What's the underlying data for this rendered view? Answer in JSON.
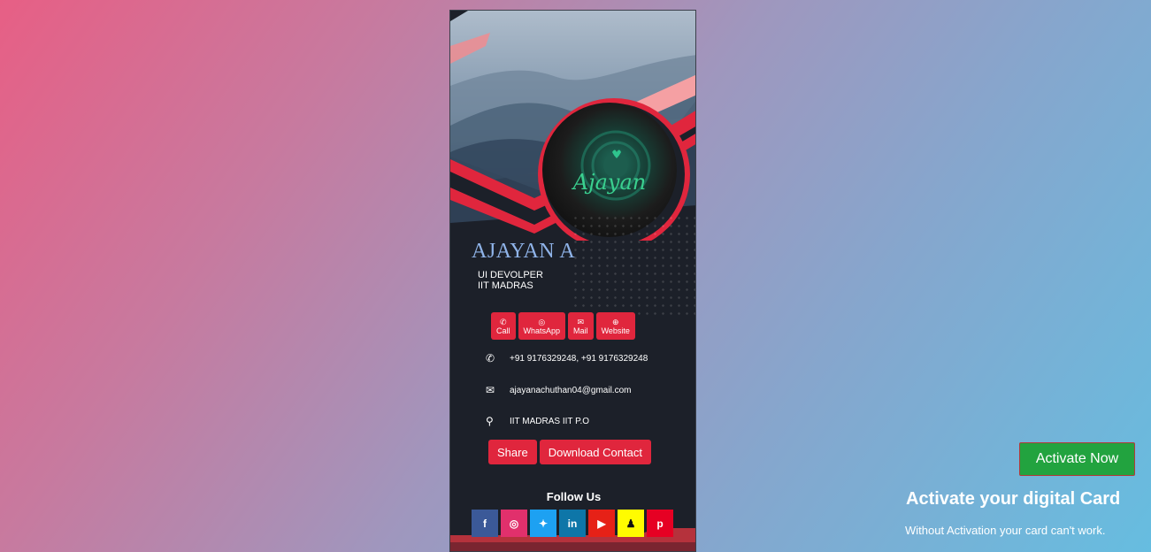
{
  "card": {
    "name": "AJAYAN A",
    "role": "UI DEVOLPER",
    "org": "IIT MADRAS",
    "logo_text": "Ajayan",
    "actions": [
      {
        "label": "Call",
        "icon": "phone-icon",
        "glyph": "✆"
      },
      {
        "label": "WhatsApp",
        "icon": "whatsapp-icon",
        "glyph": "◎"
      },
      {
        "label": "Mail",
        "icon": "mail-icon",
        "glyph": "✉"
      },
      {
        "label": "Website",
        "icon": "globe-icon",
        "glyph": "⊕"
      }
    ],
    "info": {
      "phone": "+91 9176329248, +91 9176329248",
      "email": "ajayanachuthan04@gmail.com",
      "address": "IIT MADRAS IIT P.O"
    },
    "share_label": "Share",
    "download_label": "Download Contact",
    "follow_label": "Follow Us",
    "socials": [
      {
        "name": "facebook",
        "glyph": "f",
        "color": "#3b5998",
        "fg": "#ffffff"
      },
      {
        "name": "instagram",
        "glyph": "◎",
        "color": "#e1306c",
        "fg": "#ffffff"
      },
      {
        "name": "twitter",
        "glyph": "✦",
        "color": "#1da1f2",
        "fg": "#ffffff"
      },
      {
        "name": "linkedin",
        "glyph": "in",
        "color": "#0e76a8",
        "fg": "#ffffff"
      },
      {
        "name": "youtube",
        "glyph": "▶",
        "color": "#e62117",
        "fg": "#ffffff"
      },
      {
        "name": "snapchat",
        "glyph": "♟",
        "color": "#fffc00",
        "fg": "#111111"
      },
      {
        "name": "pinterest",
        "glyph": "p",
        "color": "#e60023",
        "fg": "#ffffff"
      }
    ]
  },
  "activation": {
    "button_label": "Activate Now",
    "title": "Activate your digital Card",
    "subtitle": "Without Activation your card can't work."
  },
  "colors": {
    "accent_red": "#e0263d",
    "activate_green": "#22a33f",
    "name_blue": "#8fb3e8",
    "card_bg": "#1c2029"
  }
}
